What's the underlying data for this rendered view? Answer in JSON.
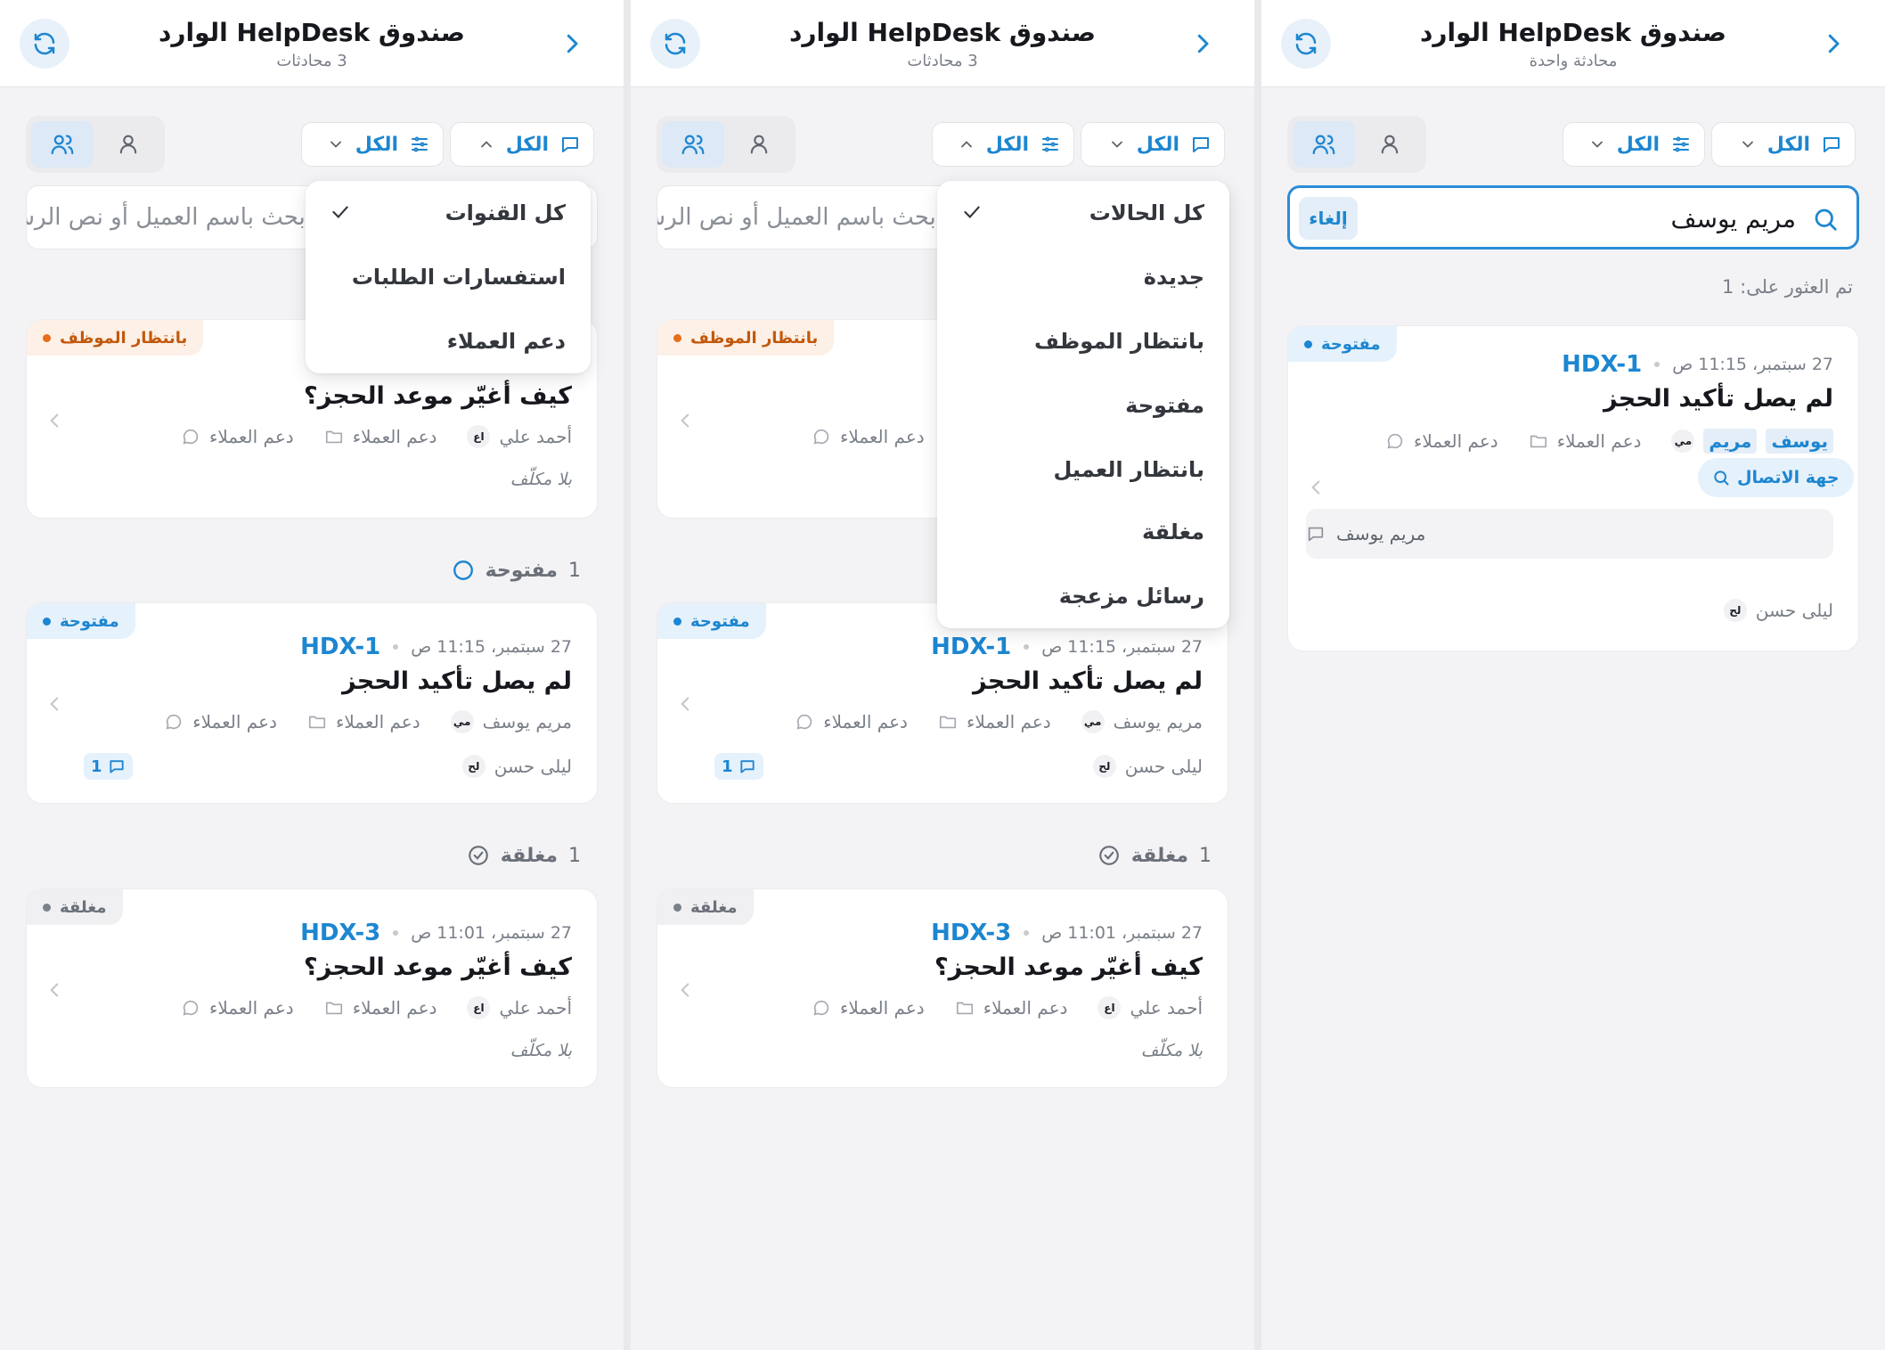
{
  "header": {
    "title": "صندوق HelpDesk الوارد"
  },
  "filters": {
    "chip_label": "الكل"
  },
  "search": {
    "placeholder": "ابحث باسم العميل أو نص الرسالة",
    "query": "مريم يوسف",
    "cancel_label": "إلغاء"
  },
  "panels": [
    {
      "subtitle": "3 محادثات"
    },
    {
      "subtitle": "3 محادثات"
    },
    {
      "subtitle": "محادثة واحدة"
    }
  ],
  "status": {
    "waiting": "بانتظار الموظف",
    "open": "مفتوحة",
    "closed": "مغلقة"
  },
  "groups": {
    "open": {
      "label": "مفتوحة",
      "count": "1"
    },
    "closed": {
      "label": "مغلقة",
      "count": "1"
    }
  },
  "tickets": {
    "t_booking": {
      "title": "كيف أغيّر موعد الحجز؟",
      "channel": "دعم العملاء",
      "team": "دعم العملاء",
      "customer_initials": "اع",
      "customer": "أحمد علي",
      "assignee": "بلا مكلّف"
    },
    "hdx1": {
      "id": "HDX-1",
      "time": "27 سبتمبر، 11:15 ص",
      "title": "لم يصل تأكيد الحجز",
      "channel": "دعم العملاء",
      "team": "دعم العملاء",
      "customer_initials": "مي",
      "customer": "مريم يوسف",
      "assignee_initials": "لح",
      "assignee": "ليلى حسن",
      "message_count": "1"
    },
    "hdx3": {
      "id": "HDX-3",
      "time": "27 سبتمبر، 11:01 ص",
      "title": "كيف أغيّر موعد الحجز؟",
      "channel": "دعم العملاء",
      "team": "دعم العملاء",
      "customer_initials": "اع",
      "customer": "أحمد علي",
      "assignee": "بلا مكلّف"
    }
  },
  "channel_menu": [
    "كل القنوات",
    "استفسارات الطلبات",
    "دعم العملاء"
  ],
  "status_menu": [
    "كل الحالات",
    "جديدة",
    "بانتظار الموظف",
    "مفتوحة",
    "بانتظار العميل",
    "مغلقة",
    "رسائل مزعجة"
  ],
  "search_result": {
    "found_label": "تم العثور على: 1",
    "contact_label": "جهة الاتصال",
    "name_part1": "مريم",
    "name_part2": "يوسف",
    "snippet": "مريم يوسف"
  },
  "colors": {
    "accent": "#1d86d0",
    "waiting": "#e56e1b",
    "closed": "#7b8089"
  }
}
